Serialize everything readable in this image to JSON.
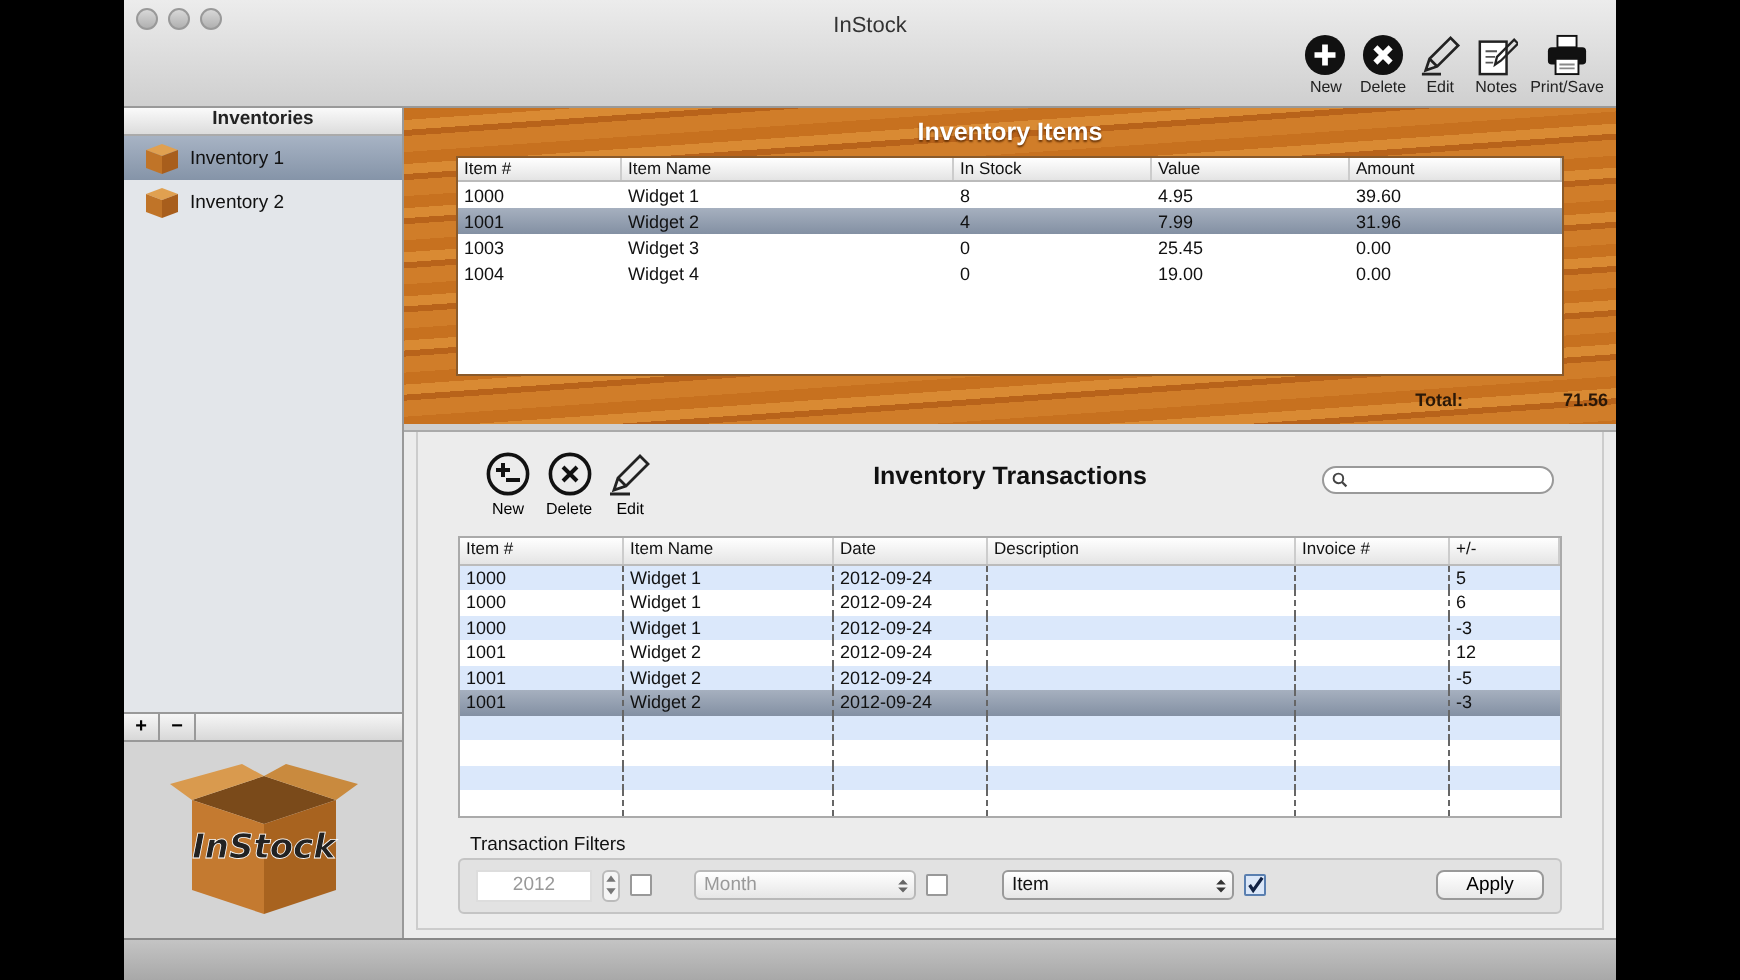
{
  "window": {
    "title": "InStock"
  },
  "toolbar": [
    {
      "label": "New",
      "kind": "new"
    },
    {
      "label": "Delete",
      "kind": "delete"
    },
    {
      "label": "Edit",
      "kind": "edit"
    },
    {
      "label": "Notes",
      "kind": "notes"
    },
    {
      "label": "Print/Save",
      "kind": "print"
    }
  ],
  "sidebar": {
    "header": "Inventories",
    "items": [
      {
        "label": "Inventory 1",
        "selected": true
      },
      {
        "label": "Inventory 2",
        "selected": false
      }
    ],
    "add_button": "+",
    "remove_button": "−",
    "logo_text": "InStock"
  },
  "items_panel": {
    "title": "Inventory Items",
    "columns": [
      "Item #",
      "Item Name",
      "In Stock",
      "Value",
      "Amount"
    ],
    "rows": [
      {
        "cells": [
          "1000",
          "Widget 1",
          "8",
          "4.95",
          "39.60"
        ],
        "selected": false
      },
      {
        "cells": [
          "1001",
          "Widget 2",
          "4",
          "7.99",
          "31.96"
        ],
        "selected": true
      },
      {
        "cells": [
          "1003",
          "Widget 3",
          "0",
          "25.45",
          "0.00"
        ],
        "selected": false
      },
      {
        "cells": [
          "1004",
          "Widget 4",
          "0",
          "19.00",
          "0.00"
        ],
        "selected": false
      }
    ],
    "total_label": "Total:",
    "total_value": "71.56"
  },
  "transactions": {
    "title": "Inventory Transactions",
    "buttons": [
      {
        "label": "New",
        "kind": "new"
      },
      {
        "label": "Delete",
        "kind": "delete"
      },
      {
        "label": "Edit",
        "kind": "edit"
      }
    ],
    "columns": [
      "Item #",
      "Item Name",
      "Date",
      "Description",
      "Invoice #",
      "+/-"
    ],
    "rows": [
      {
        "cells": [
          "1000",
          "Widget 1",
          "2012-09-24",
          "",
          "",
          "5"
        ],
        "selected": false
      },
      {
        "cells": [
          "1000",
          "Widget 1",
          "2012-09-24",
          "",
          "",
          "6"
        ],
        "selected": false
      },
      {
        "cells": [
          "1000",
          "Widget 1",
          "2012-09-24",
          "",
          "",
          "-3"
        ],
        "selected": false
      },
      {
        "cells": [
          "1001",
          "Widget 2",
          "2012-09-24",
          "",
          "",
          "12"
        ],
        "selected": false
      },
      {
        "cells": [
          "1001",
          "Widget 2",
          "2012-09-24",
          "",
          "",
          "-5"
        ],
        "selected": false
      },
      {
        "cells": [
          "1001",
          "Widget 2",
          "2012-09-24",
          "",
          "",
          "-3"
        ],
        "selected": true
      }
    ]
  },
  "filters": {
    "title": "Transaction Filters",
    "year": {
      "value": "2012",
      "disabled": true,
      "checked": false
    },
    "period": {
      "value": "Month",
      "disabled": true,
      "checked": false
    },
    "group": {
      "value": "Item",
      "disabled": false,
      "checked": true
    },
    "apply": "Apply"
  }
}
